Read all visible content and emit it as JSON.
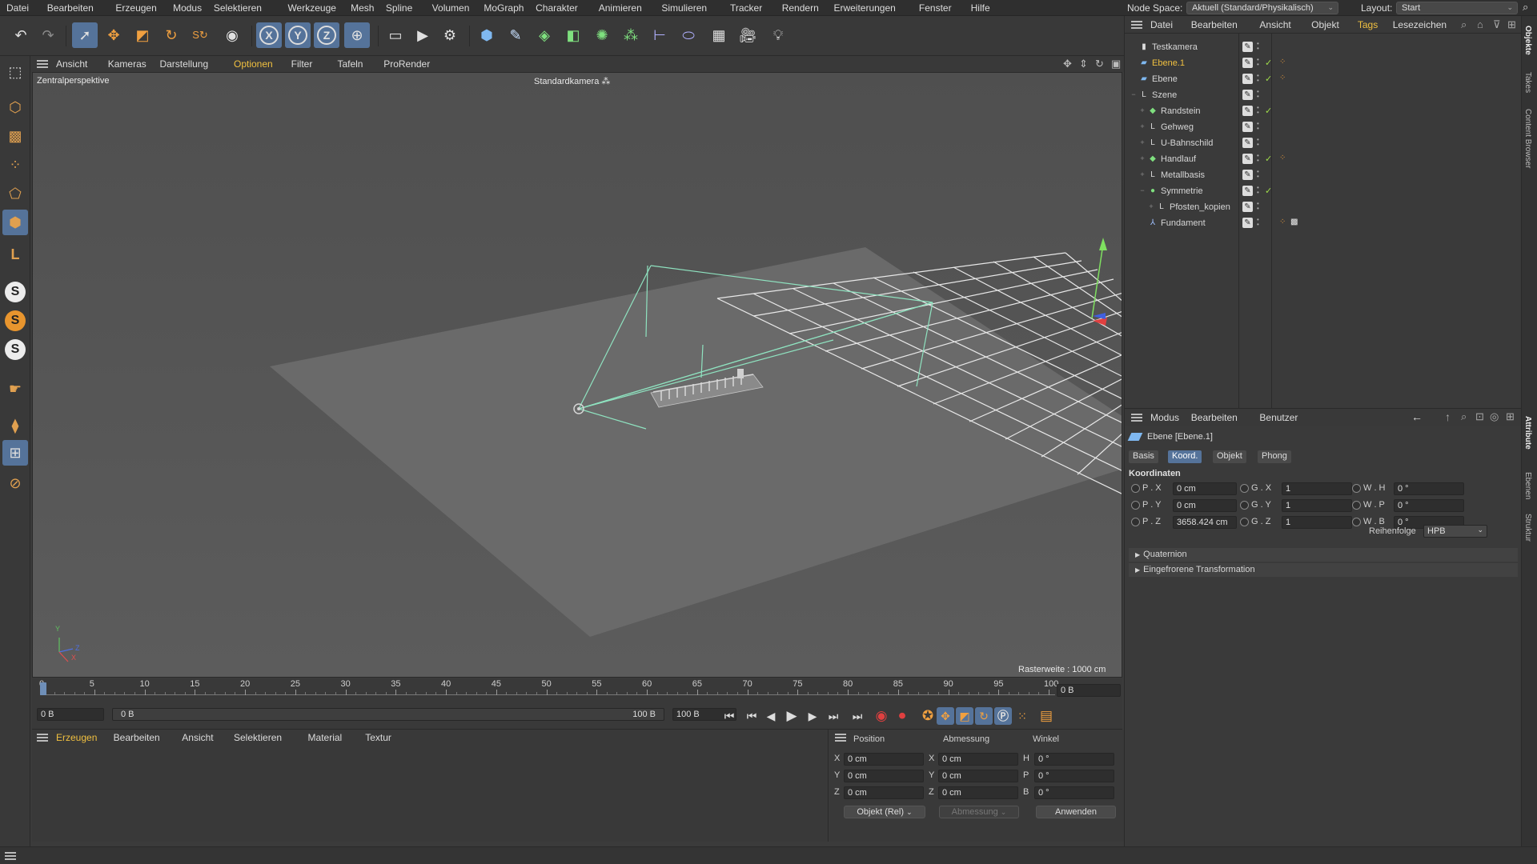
{
  "menubar": {
    "items": [
      "Datei",
      "Bearbeiten",
      "Erzeugen",
      "Modus",
      "Selektieren",
      "Werkzeuge",
      "Mesh",
      "Spline",
      "Volumen",
      "MoGraph",
      "Charakter",
      "Animieren",
      "Simulieren",
      "Tracker",
      "Rendern",
      "Erweiterungen",
      "Fenster",
      "Hilfe"
    ],
    "node_space_label": "Node Space:",
    "node_space_value": "Aktuell (Standard/Physikalisch)",
    "layout_label": "Layout:",
    "layout_value": "Start"
  },
  "toolbar": {
    "icons": [
      "undo-icon",
      "redo-icon",
      "select-icon",
      "move-icon",
      "scale-icon",
      "rotate-icon",
      "recent-tools-icon",
      "live-select-icon",
      "x-axis-icon",
      "y-axis-icon",
      "z-axis-icon",
      "coordinate-system-icon",
      "render-region-icon",
      "render-view-icon",
      "render-settings-icon",
      "cube-icon",
      "pen-icon",
      "subdivision-icon",
      "extrude-icon",
      "cloner-icon",
      "array-icon",
      "deformer-icon",
      "field-icon",
      "floor-icon",
      "camera-icon",
      "light-icon"
    ],
    "axis_x": "X",
    "axis_y": "Y",
    "axis_z": "Z"
  },
  "left_toolbar": {
    "s_label": "S",
    "l_label": "L"
  },
  "viewport": {
    "menu": [
      "Ansicht",
      "Kameras",
      "Darstellung",
      "Optionen",
      "Filter",
      "Tafeln",
      "ProRender"
    ],
    "view_name": "Zentralperspektive",
    "camera_name": "Standardkamera",
    "grid_info": "Rasterweite : 1000 cm",
    "axis_y": "Y",
    "axis_z": "Z",
    "axis_x": "X"
  },
  "timeline": {
    "ticks": [
      "0",
      "5",
      "10",
      "15",
      "20",
      "25",
      "30",
      "35",
      "40",
      "45",
      "50",
      "55",
      "60",
      "65",
      "70",
      "75",
      "80",
      "85",
      "90",
      "95",
      "100"
    ],
    "current_frame": "0 B",
    "start_field": "0 B",
    "range_start": "0 B",
    "range_end": "100 B",
    "end_field": "100 B"
  },
  "material_manager": {
    "menu": [
      "Erzeugen",
      "Bearbeiten",
      "Ansicht",
      "Selektieren",
      "Material",
      "Textur"
    ]
  },
  "coord_manager": {
    "headers": {
      "position": "Position",
      "size": "Abmessung",
      "rotation": "Winkel"
    },
    "rows": [
      {
        "axis": "X",
        "pos": "0 cm",
        "size_axis": "X",
        "size": "0 cm",
        "rot_axis": "H",
        "rot": "0 °"
      },
      {
        "axis": "Y",
        "pos": "0 cm",
        "size_axis": "Y",
        "size": "0 cm",
        "rot_axis": "P",
        "rot": "0 °"
      },
      {
        "axis": "Z",
        "pos": "0 cm",
        "size_axis": "Z",
        "size": "0 cm",
        "rot_axis": "B",
        "rot": "0 °"
      }
    ],
    "mode_select": "Objekt (Rel)",
    "size_select": "Abmessung",
    "apply_button": "Anwenden"
  },
  "object_manager": {
    "menu": [
      "Datei",
      "Bearbeiten",
      "Ansicht",
      "Objekt",
      "Tags",
      "Lesezeichen"
    ],
    "objects": [
      {
        "name": "Testkamera",
        "indent": 0,
        "expand": "",
        "icon": "camera-object-icon",
        "tick": false,
        "tags": 0,
        "highlight": false
      },
      {
        "name": "Ebene.1",
        "indent": 0,
        "expand": "",
        "icon": "plane-object-icon",
        "tick": true,
        "tags": 1,
        "highlight": true
      },
      {
        "name": "Ebene",
        "indent": 0,
        "expand": "",
        "icon": "plane-object-icon",
        "tick": true,
        "tags": 1,
        "highlight": false
      },
      {
        "name": "Szene",
        "indent": 0,
        "expand": "−",
        "icon": "null-object-icon",
        "tick": false,
        "tags": 0,
        "highlight": false
      },
      {
        "name": "Randstein",
        "indent": 1,
        "expand": "+",
        "icon": "generator-object-icon",
        "tick": true,
        "tags": 0,
        "highlight": false
      },
      {
        "name": "Gehweg",
        "indent": 1,
        "expand": "+",
        "icon": "null-object-icon",
        "tick": false,
        "tags": 0,
        "highlight": false
      },
      {
        "name": "U-Bahnschild",
        "indent": 1,
        "expand": "+",
        "icon": "null-object-icon",
        "tick": false,
        "tags": 0,
        "highlight": false
      },
      {
        "name": "Handlauf",
        "indent": 1,
        "expand": "+",
        "icon": "generator-object-icon",
        "tick": true,
        "tags": 1,
        "highlight": false
      },
      {
        "name": "Metallbasis",
        "indent": 1,
        "expand": "+",
        "icon": "null-object-icon",
        "tick": false,
        "tags": 0,
        "highlight": false
      },
      {
        "name": "Symmetrie",
        "indent": 1,
        "expand": "−",
        "icon": "symmetry-object-icon",
        "tick": true,
        "tags": 0,
        "highlight": false
      },
      {
        "name": "Pfosten_kopien",
        "indent": 2,
        "expand": "+",
        "icon": "null-object-icon",
        "tick": false,
        "tags": 0,
        "highlight": false
      },
      {
        "name": "Fundament",
        "indent": 1,
        "expand": "",
        "icon": "joint-object-icon",
        "tick": false,
        "tags": 2,
        "highlight": false
      }
    ]
  },
  "attribute_manager": {
    "menu": [
      "Modus",
      "Bearbeiten",
      "Benutzer"
    ],
    "object_title": "Ebene [Ebene.1]",
    "tabs": [
      "Basis",
      "Koord.",
      "Objekt",
      "Phong"
    ],
    "active_tab": 1,
    "section_title": "Koordinaten",
    "rows": [
      {
        "p_label": "P . X",
        "p_val": "0 cm",
        "g_label": "G . X",
        "g_val": "1",
        "w_label": "W . H",
        "w_val": "0 °"
      },
      {
        "p_label": "P . Y",
        "p_val": "0 cm",
        "g_label": "G . Y",
        "g_val": "1",
        "w_label": "W . P",
        "w_val": "0 °"
      },
      {
        "p_label": "P . Z",
        "p_val": "3658.424 cm",
        "g_label": "G . Z",
        "g_val": "1",
        "w_label": "W . B",
        "w_val": "0 °"
      }
    ],
    "order_label": "Reihenfolge",
    "order_value": "HPB",
    "collapsed_sections": [
      "Quaternion",
      "Eingefrorene Transformation"
    ]
  },
  "side_tabs": {
    "top": [
      "Objekte",
      "Takes",
      "Content Browser"
    ],
    "bottom": [
      "Attribute",
      "Ebenen",
      "Struktur"
    ]
  },
  "colors": {
    "accent": "#55739a",
    "highlight_text": "#f0c040",
    "grid_line": "#e8e8e8",
    "camera_line": "#8fe3c0",
    "tick_green": "#9fdc4a",
    "tag_orange": "#e89b3a"
  }
}
